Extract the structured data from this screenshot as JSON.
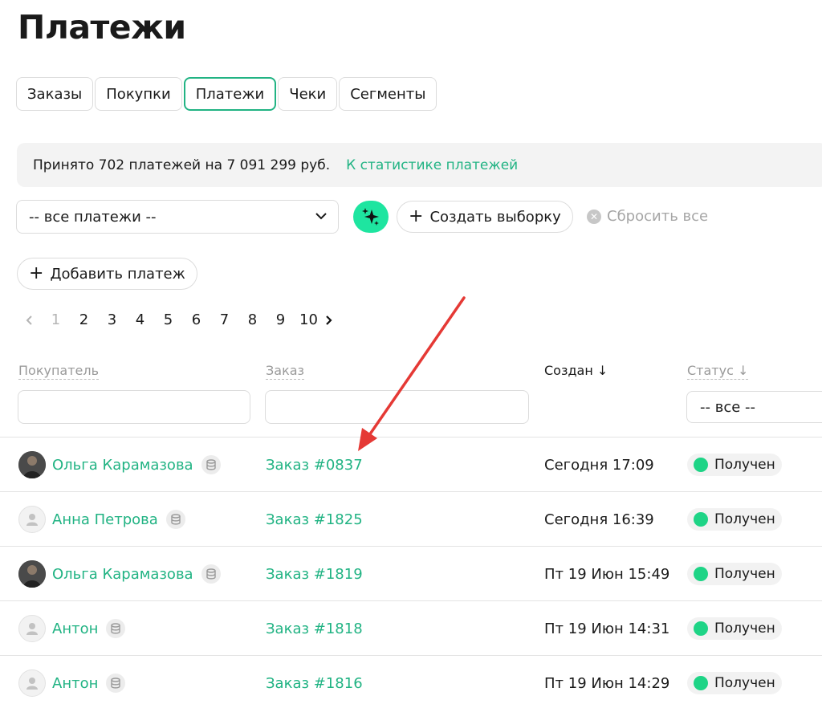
{
  "page": {
    "title": "Платежи"
  },
  "tabs": [
    {
      "label": "Заказы"
    },
    {
      "label": "Покупки"
    },
    {
      "label": "Платежи",
      "active": true
    },
    {
      "label": "Чеки"
    },
    {
      "label": "Сегменты"
    }
  ],
  "stats": {
    "text": "Принято 702 платежей на 7 091 299 руб.",
    "link": "К статистике платежей"
  },
  "filters": {
    "payment_select": "-- все платежи --",
    "create_selection": "Создать выборку",
    "reset_all": "Сбросить все",
    "add_payment": "Добавить платеж"
  },
  "pagination": {
    "pages": [
      "1",
      "2",
      "3",
      "4",
      "5",
      "6",
      "7",
      "8",
      "9",
      "10"
    ],
    "current": "1"
  },
  "table": {
    "columns": {
      "buyer": "Покупатель",
      "order": "Заказ",
      "created": "Создан ↓",
      "status": "Статус ↓"
    },
    "status_filter": "-- все --",
    "rows": [
      {
        "buyer": "Ольга Карамазова",
        "avatar": "photo",
        "order": "Заказ #0837",
        "created": "Сегодня 17:09",
        "status": "Получен"
      },
      {
        "buyer": "Анна Петрова",
        "avatar": "user-icon",
        "order": "Заказ #1825",
        "created": "Сегодня 16:39",
        "status": "Получен"
      },
      {
        "buyer": "Ольга Карамазова",
        "avatar": "photo",
        "order": "Заказ #1819",
        "created": "Пт 19 Июн 15:49",
        "status": "Получен"
      },
      {
        "buyer": "Антон",
        "avatar": "user-icon",
        "order": "Заказ #1818",
        "created": "Пт 19 Июн 14:31",
        "status": "Получен"
      },
      {
        "buyer": "Антон",
        "avatar": "user-icon",
        "order": "Заказ #1816",
        "created": "Пт 19 Июн 14:29",
        "status": "Получен"
      }
    ]
  },
  "colors": {
    "accent": "#21b383",
    "ai_button": "#1ee5a0",
    "status_ok": "#1ed486",
    "annotation_arrow": "#e53935"
  }
}
